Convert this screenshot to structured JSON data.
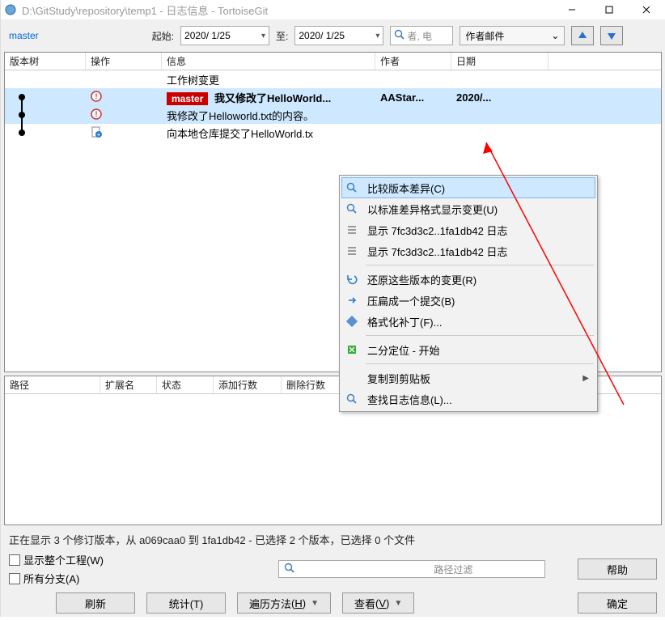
{
  "title": "D:\\GitStudy\\repository\\temp1 - 日志信息 - TortoiseGit",
  "branch": "master",
  "filter": {
    "from_label": "起始:",
    "to_label": "至:",
    "from_date": "2020/ 1/25",
    "to_date": "2020/ 1/25",
    "search_placeholder": "者, 电",
    "author_select": "作者邮件"
  },
  "log_columns": {
    "tree": "版本树",
    "action": "操作",
    "message": "信息",
    "author": "作者",
    "date": "日期"
  },
  "log_rows": [
    {
      "tree": "",
      "action": "",
      "message": "工作树变更",
      "author": "",
      "date": "",
      "selected": false,
      "branch_tag": "",
      "action_icon": ""
    },
    {
      "tree": "",
      "action": "mod",
      "message": "我又修改了HelloWorld...",
      "author": "AAStar...",
      "date": "2020/...",
      "selected": true,
      "branch_tag": "master",
      "action_icon": "modified"
    },
    {
      "tree": "",
      "action": "mod",
      "message": "我修改了Helloworld.txt的内容。",
      "author": "",
      "date": "",
      "selected": true,
      "branch_tag": "",
      "action_icon": "modified"
    },
    {
      "tree": "",
      "action": "add",
      "message": "向本地仓库提交了HelloWorld.tx",
      "author": "",
      "date": "",
      "selected": false,
      "branch_tag": "",
      "action_icon": "added"
    }
  ],
  "context_menu": [
    {
      "icon": "search-icon",
      "label": "比较版本差异(C)",
      "highlight": true
    },
    {
      "icon": "search-icon",
      "label": "以标准差异格式显示变更(U)"
    },
    {
      "icon": "log-icon",
      "label": "显示 7fc3d3c2..1fa1db42 日志"
    },
    {
      "icon": "log-icon",
      "label": "显示 7fc3d3c2..1fa1db42 日志"
    },
    {
      "sep": true
    },
    {
      "icon": "revert-icon",
      "label": "还原这些版本的变更(R)"
    },
    {
      "icon": "squash-icon",
      "label": "压扁成一个提交(B)"
    },
    {
      "icon": "patch-icon",
      "label": "格式化补丁(F)..."
    },
    {
      "sep": true
    },
    {
      "icon": "bisect-icon",
      "label": "二分定位 - 开始"
    },
    {
      "sep": true
    },
    {
      "icon": "",
      "label": "复制到剪贴板",
      "submenu": true
    },
    {
      "icon": "search-icon",
      "label": "查找日志信息(L)..."
    }
  ],
  "files_columns": {
    "path": "路径",
    "ext": "扩展名",
    "status": "状态",
    "add": "添加行数",
    "del": "删除行数"
  },
  "status_line": "正在显示 3 个修订版本，从 a069caa0 到 1fa1db42 - 已选择 2 个版本，已选择 0 个文件",
  "options": {
    "whole_project": "显示整个工程(W)",
    "all_branches": "所有分支(A)",
    "path_filter_placeholder": "路径过滤"
  },
  "buttons": {
    "help": "帮助",
    "refresh": "刷新",
    "stats": "统计(T)",
    "walk": "遍历方法",
    "walk_u": "H",
    "view": "查看",
    "view_u": "V",
    "ok": "确定"
  }
}
